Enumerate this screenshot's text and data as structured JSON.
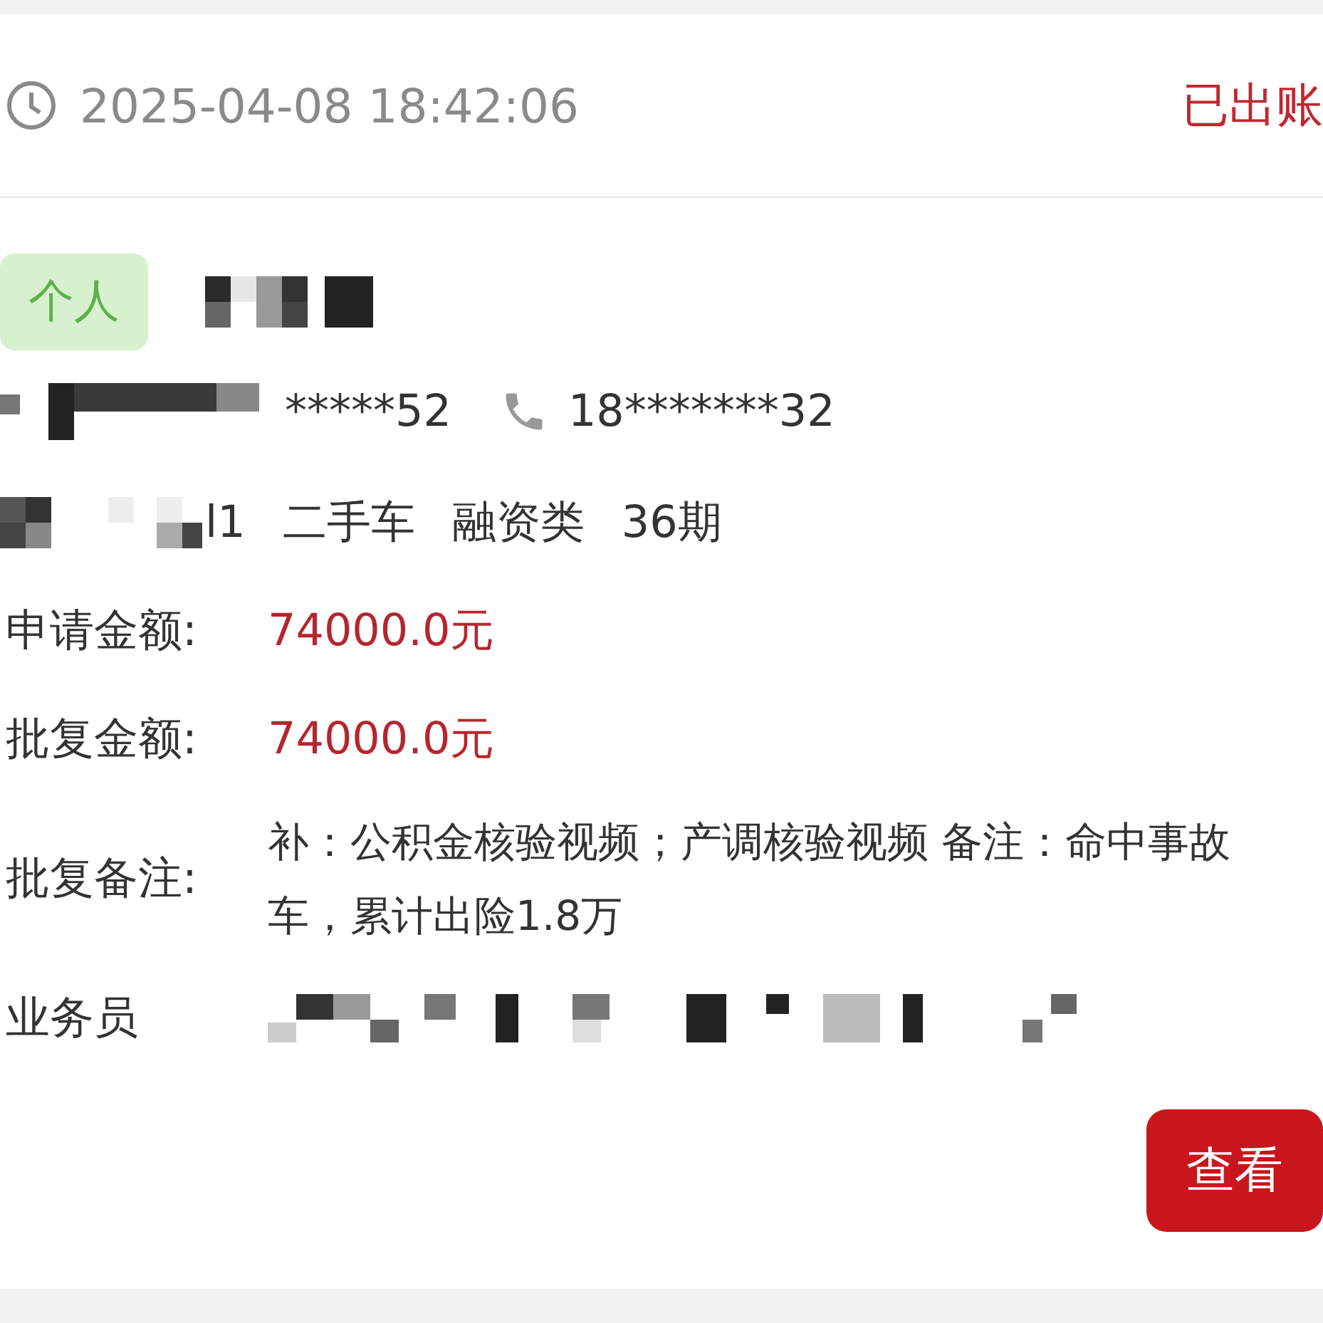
{
  "header": {
    "time": "2025-04-08 18:42:06",
    "status": "已出账"
  },
  "customer": {
    "tag": "个人"
  },
  "id_number": {
    "visible_suffix": "*****52"
  },
  "phone": "18*******32",
  "loan_info": {
    "visible_fragment": "l1",
    "items": [
      "二手车",
      "融资类",
      "36期"
    ]
  },
  "fields": [
    {
      "label": "申请金额:",
      "value": "74000.0元",
      "kind": "amount"
    },
    {
      "label": "批复金额:",
      "value": "74000.0元",
      "kind": "amount"
    },
    {
      "label": "批复备注:",
      "value": "补：公积金核验视频；产调核验视频 备注：命中事故车，累计出险1.8万",
      "kind": "note"
    },
    {
      "label": "业务员",
      "kind": "redacted"
    }
  ],
  "button": "查看"
}
